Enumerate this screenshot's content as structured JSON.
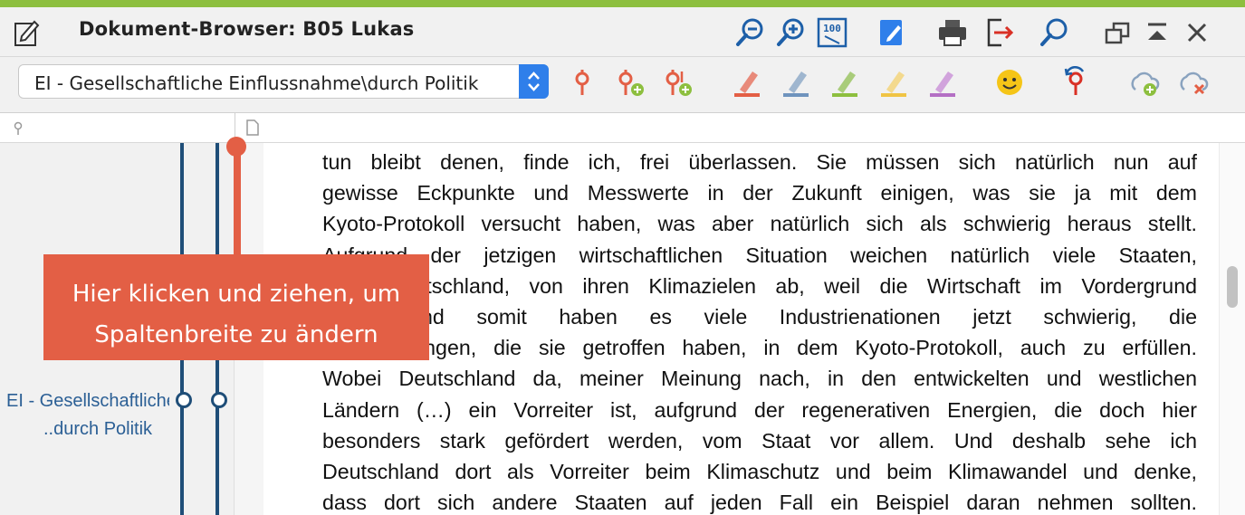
{
  "window": {
    "title": "Dokument-Browser: B05 Lukas"
  },
  "toolbar": {
    "code_select_value": "EI - Gesellschaftliche Einflussnahme\\durch Politik"
  },
  "left_panel": {
    "code_label_line1": "EI - Gesellschaftliche Einflussnahme",
    "code_label_line2": "..durch Politik"
  },
  "tooltip": {
    "line1": "Hier klicken und ziehen, um",
    "line2": "Spaltenbreite zu ändern"
  },
  "document": {
    "lines": [
      "tun bleibt denen, finde ich, frei überlassen. Sie müssen sich natürlich nun auf",
      "gewisse Eckpunkte und Messwerte in der Zukunft einigen, was sie ja mit dem",
      "Kyoto-Protokoll versucht haben, was aber natürlich sich als schwierig heraus stellt.",
      "Aufgrund der jetzigen wirtschaftlichen Situation weichen natürlich viele Staaten,",
      "auch Deutschland, von ihren Klimazielen ab, weil die Wirtschaft im Vordergrund",
      "steht. Und somit haben es viele Industrienationen jetzt schwierig, die",
      "Vereinbarungen, die sie getroffen haben, in dem Kyoto-Protokoll, auch zu erfüllen.",
      "Wobei Deutschland da, meiner Meinung nach, in den entwickelten und westlichen",
      "Ländern (…) ein Vorreiter ist, aufgrund der regenerativen Energien, die doch hier",
      "besonders stark gefördert werden, vom Staat vor allem. Und deshalb sehe ich",
      "Deutschland dort als Vorreiter beim Klimaschutz und beim Klimawandel und denke,",
      "dass dort sich andere Staaten auf jeden Fall ein Beispiel daran nehmen sollten."
    ]
  },
  "icons": {
    "accent": "#2f7fea",
    "highlight_red": "#e35f45",
    "code_line": "#1f4e78",
    "top_stripe": "#8dbf3f"
  }
}
